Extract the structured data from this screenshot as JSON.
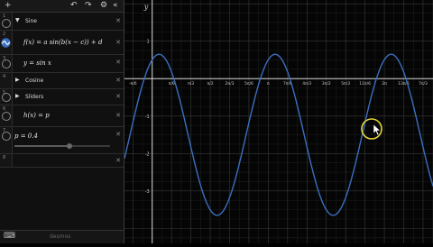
{
  "toolbar": {
    "add_icon": "+",
    "undo_icon": "↶",
    "redo_icon": "↷",
    "settings_icon": "⚙",
    "collapse_icon": "«"
  },
  "folders": {
    "sine": {
      "label": "Sine"
    },
    "cosine": {
      "label": "Cosine"
    },
    "sliders": {
      "label": "Sliders"
    }
  },
  "expressions": {
    "f": "f(x) = a sin(b(x − c)) + d",
    "y": "y = sin x",
    "h": "h(x) = p",
    "p": "p = 0.4"
  },
  "rownums": [
    "1",
    "2",
    "3",
    "4",
    "5",
    "6",
    "7",
    "8"
  ],
  "footer": {
    "keyboard_icon": "⌨",
    "brand": "desmos"
  },
  "graph": {
    "axis_y_label": "y",
    "x_ticks": [
      "-π/6",
      "π/6",
      "π/3",
      "π/2",
      "2π/3",
      "5π/6",
      "π",
      "7π/6",
      "4π/3",
      "3π/2",
      "5π/3",
      "11π/6",
      "2π",
      "13π/6",
      "7π/3"
    ],
    "y_ticks": [
      "1",
      "-1",
      "-2",
      "-3"
    ],
    "curve_color": "#3b6fbf"
  },
  "chart_data": {
    "type": "line",
    "series": [
      {
        "formula": "f(x) = a sin(b(x − c)) + d"
      }
    ],
    "xlim": [
      -0.75,
      7.6
    ],
    "ylim": [
      -4.4,
      2.1
    ]
  }
}
